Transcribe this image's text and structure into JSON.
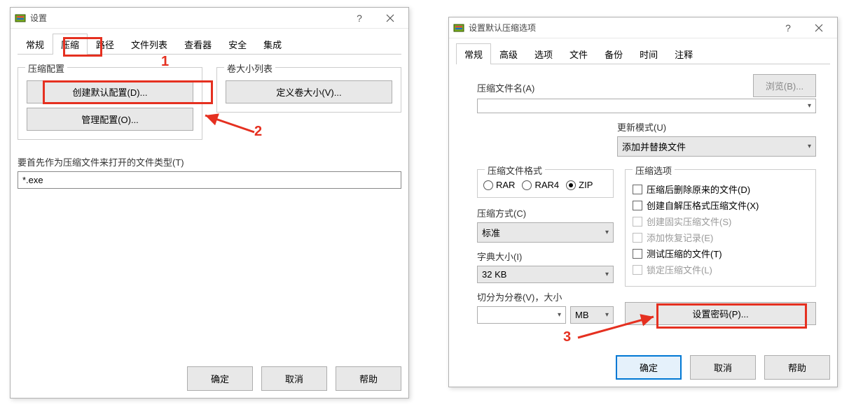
{
  "dialog1": {
    "title": "设置",
    "tabs": [
      "常规",
      "压缩",
      "路径",
      "文件列表",
      "查看器",
      "安全",
      "集成"
    ],
    "active_tab": 1,
    "group_compress": {
      "legend": "压缩配置",
      "btn_create_default": "创建默认配置(D)...",
      "btn_manage": "管理配置(O)..."
    },
    "group_volume": {
      "legend": "卷大小列表",
      "btn_define": "定义卷大小(V)..."
    },
    "open_types_label": "要首先作为压缩文件来打开的文件类型(T)",
    "open_types_value": "*.exe",
    "footer": {
      "ok": "确定",
      "cancel": "取消",
      "help": "帮助"
    },
    "annot": {
      "num1": "1",
      "num2": "2"
    }
  },
  "dialog2": {
    "title": "设置默认压缩选项",
    "tabs": [
      "常规",
      "高级",
      "选项",
      "文件",
      "备份",
      "时间",
      "注释"
    ],
    "active_tab": 0,
    "archive_name_label": "压缩文件名(A)",
    "archive_name_value": "",
    "browse_btn": "浏览(B)...",
    "update_mode_label": "更新模式(U)",
    "update_mode_value": "添加并替换文件",
    "format_group": {
      "legend": "压缩文件格式",
      "options": [
        "RAR",
        "RAR4",
        "ZIP"
      ],
      "selected": 2
    },
    "method_label": "压缩方式(C)",
    "method_value": "标准",
    "dict_label": "字典大小(I)",
    "dict_value": "32 KB",
    "split_label": "切分为分卷(V)，大小",
    "split_value": "",
    "split_unit": "MB",
    "options_group": {
      "legend": "压缩选项",
      "items": [
        {
          "label": "压缩后删除原来的文件(D)",
          "disabled": false
        },
        {
          "label": "创建自解压格式压缩文件(X)",
          "disabled": false
        },
        {
          "label": "创建固实压缩文件(S)",
          "disabled": true
        },
        {
          "label": "添加恢复记录(E)",
          "disabled": true
        },
        {
          "label": "测试压缩的文件(T)",
          "disabled": false
        },
        {
          "label": "锁定压缩文件(L)",
          "disabled": true
        }
      ]
    },
    "password_btn": "设置密码(P)...",
    "footer": {
      "ok": "确定",
      "cancel": "取消",
      "help": "帮助"
    },
    "annot": {
      "num3": "3"
    }
  }
}
